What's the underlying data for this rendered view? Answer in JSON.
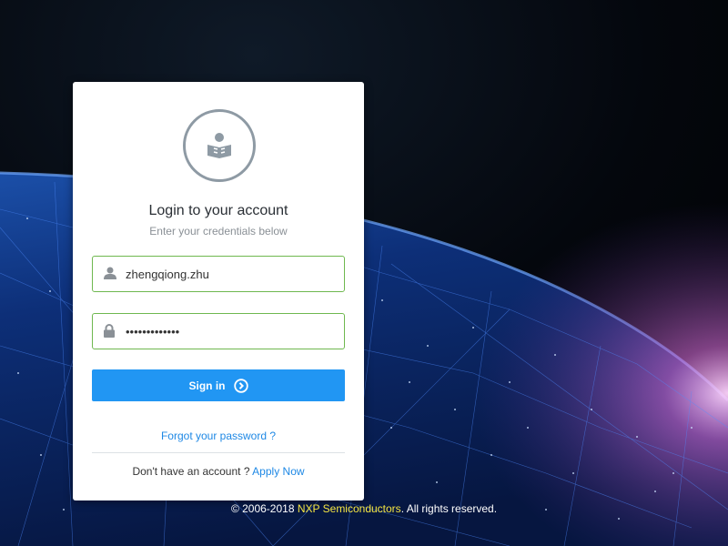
{
  "login": {
    "title": "Login to your account",
    "subtitle": "Enter your credentials below",
    "username_value": "zhengqiong.zhu",
    "password_value": "•••••••••••••",
    "signin_label": "Sign in",
    "forgot_label": "Forgot your password ?",
    "no_account_text": "Don't have an account ?",
    "apply_label": "Apply Now"
  },
  "footer": {
    "prefix": "© 2006-2018",
    "brand": "NXP Semiconductors",
    "suffix": ". All rights reserved."
  },
  "icons": {
    "avatar": "reader-icon",
    "username": "user-icon",
    "password": "lock-icon",
    "signin": "circle-arrow-right-icon"
  },
  "colors": {
    "accent": "#2196f3",
    "link": "#1e88e5",
    "field_border": "#6fb84f",
    "brand_text": "#f5e642"
  }
}
